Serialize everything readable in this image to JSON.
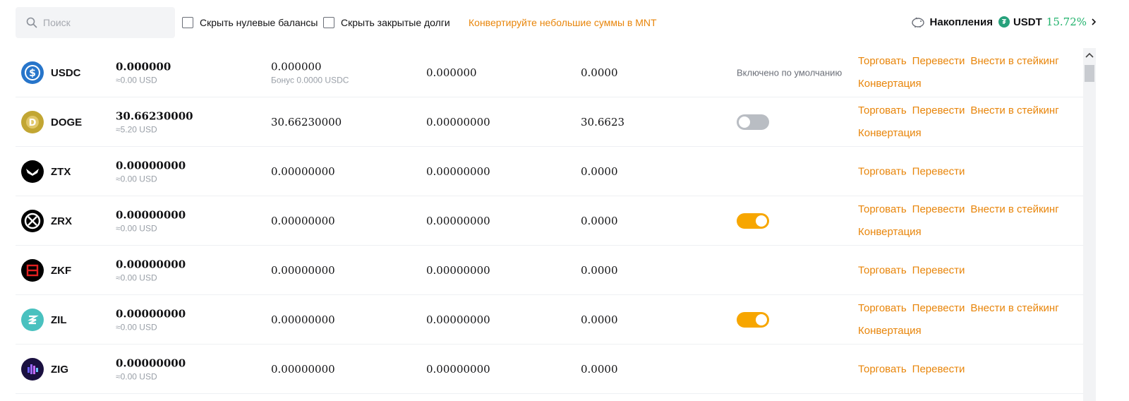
{
  "search": {
    "placeholder": "Поиск"
  },
  "filters": {
    "hide_zero": "Скрыть нулевые балансы",
    "hide_closed": "Скрыть закрытые долги",
    "convert_link": "Конвертируйте небольшие суммы в MNT"
  },
  "savings": {
    "label": "Накопления",
    "coin": "USDT",
    "rate": "15.72%"
  },
  "actions": {
    "trade": "Торговать",
    "transfer": "Перевести",
    "stake": "Внести в стейкинг",
    "convert": "Конвертация"
  },
  "rows": [
    {
      "symbol": "USDC",
      "total": "0.000000",
      "total_usd": "≈0.00 USD",
      "available": "0.000000",
      "bonus": "Бонус 0.0000 USDC",
      "in_order": "0.000000",
      "usd": "0.0000",
      "status_text": "Включено по умолчанию",
      "toggle": null,
      "icon": "usdc-icon"
    },
    {
      "symbol": "DOGE",
      "total": "30.66230000",
      "total_usd": "≈5.20 USD",
      "available": "30.66230000",
      "in_order": "0.00000000",
      "usd": "30.6623",
      "toggle": "off",
      "icon": "doge-icon"
    },
    {
      "symbol": "ZTX",
      "total": "0.00000000",
      "total_usd": "≈0.00 USD",
      "available": "0.00000000",
      "in_order": "0.00000000",
      "usd": "0.0000",
      "toggle": null,
      "icon": "ztx-icon"
    },
    {
      "symbol": "ZRX",
      "total": "0.00000000",
      "total_usd": "≈0.00 USD",
      "available": "0.00000000",
      "in_order": "0.00000000",
      "usd": "0.0000",
      "toggle": "on",
      "icon": "zrx-icon"
    },
    {
      "symbol": "ZKF",
      "total": "0.00000000",
      "total_usd": "≈0.00 USD",
      "available": "0.00000000",
      "in_order": "0.00000000",
      "usd": "0.0000",
      "toggle": null,
      "icon": "zkf-icon"
    },
    {
      "symbol": "ZIL",
      "total": "0.00000000",
      "total_usd": "≈0.00 USD",
      "available": "0.00000000",
      "in_order": "0.00000000",
      "usd": "0.0000",
      "toggle": "on",
      "icon": "zil-icon"
    },
    {
      "symbol": "ZIG",
      "total": "0.00000000",
      "total_usd": "≈0.00 USD",
      "available": "0.00000000",
      "in_order": "0.00000000",
      "usd": "0.0000",
      "toggle": null,
      "icon": "zig-icon"
    }
  ],
  "colors": {
    "accent": "#e8850a",
    "toggle_on": "#f7a600",
    "toggle_off": "#b9bdc3",
    "positive": "#20b26c"
  }
}
